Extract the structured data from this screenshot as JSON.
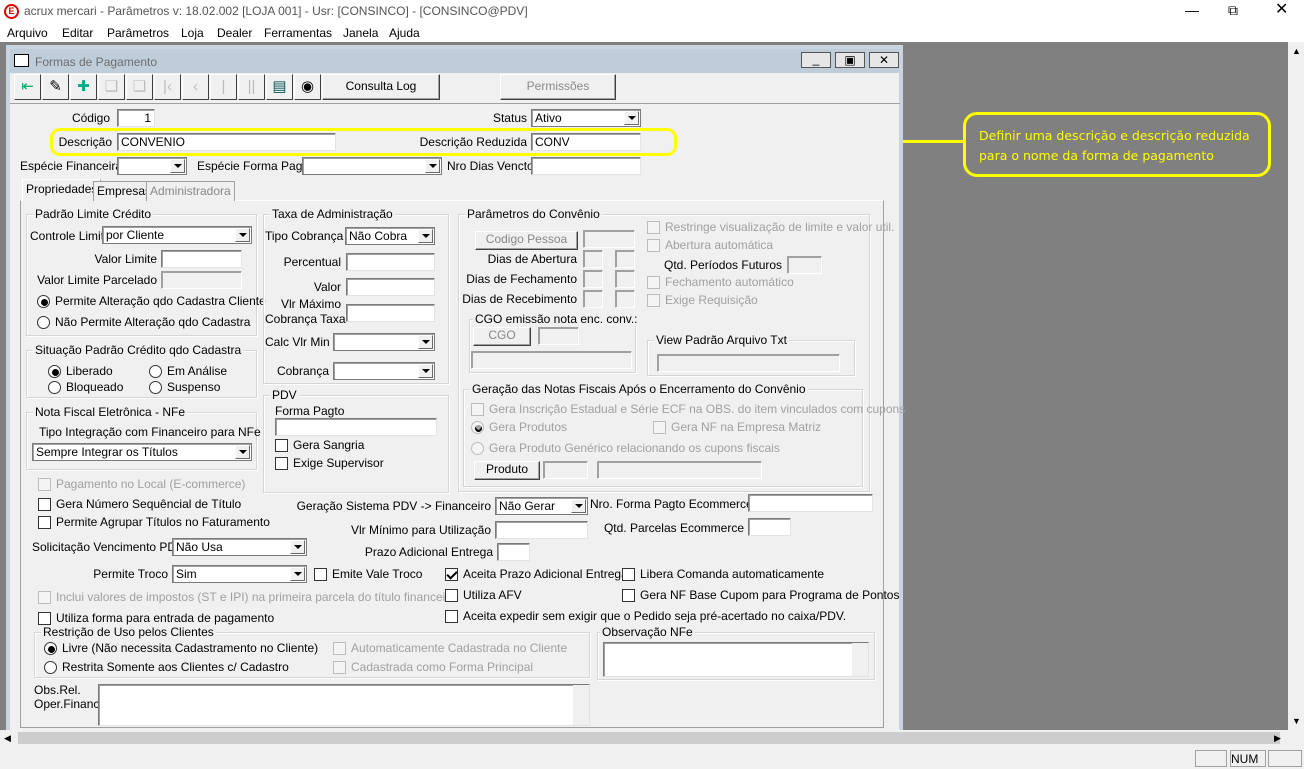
{
  "app": {
    "title": "acrux mercari - Parâmetros  v: 18.02.002   [LOJA 001] - Usr: [CONSINCO] - [CONSINCO@PDV]",
    "menu": [
      "Arquivo",
      "Editar",
      "Parâmetros",
      "Loja",
      "Dealer",
      "Ferramentas",
      "Janela",
      "Ajuda"
    ]
  },
  "window": {
    "title": "Formas de Pagamento"
  },
  "toolbar": {
    "consulta_log": "Consulta Log",
    "permissoes": "Permissões"
  },
  "header": {
    "codigo_label": "Código",
    "codigo": "1",
    "status_label": "Status",
    "status": "Ativo",
    "descricao_label": "Descrição",
    "descricao": "CONVENIO",
    "desc_reduzida_label": "Descrição Reduzida",
    "desc_reduzida": "CONV",
    "especie_fin_label": "Espécie Financeira",
    "especie_forma_label": "Espécie Forma Pagto",
    "nro_dias_label": "Nro Dias Vencto"
  },
  "callout": {
    "line1": "Definir uma descrição e descrição reduzida",
    "line2": "para o nome da forma de pagamento",
    "color": "#ffff00"
  },
  "tabs": [
    "Propriedades",
    "Empresas",
    "Administradora"
  ],
  "limite": {
    "title": "Padrão Limite Crédito",
    "controle_label": "Controle Limite",
    "controle": "por Cliente",
    "valor_label": "Valor Limite",
    "parcelado_label": "Valor Limite Parcelado",
    "radio1": "Permite Alteração qdo Cadastra Cliente",
    "radio2": "Não Permite Alteração qdo Cadastra"
  },
  "situacao": {
    "title": "Situação Padrão Crédito qdo Cadastra",
    "options": [
      "Liberado",
      "Em Análise",
      "Bloqueado",
      "Suspenso"
    ]
  },
  "nfe": {
    "title": "Nota Fiscal Eletrônica - NFe",
    "label": "Tipo Integração com Financeiro para NFe",
    "value": "Sempre Integrar os Títulos"
  },
  "taxa": {
    "title": "Taxa de Administração",
    "tipo_label": "Tipo Cobrança",
    "tipo": "Não Cobra",
    "percentual": "Percentual",
    "valor": "Valor",
    "vlr_max1": "Vlr Máximo",
    "vlr_max2": "Cobrança Taxa",
    "calc_min": "Calc Vlr Min",
    "cobranca": "Cobrança"
  },
  "pdv": {
    "title": "PDV",
    "forma_label": "Forma Pagto",
    "sangria": "Gera Sangria",
    "supervisor": "Exige Supervisor"
  },
  "convenio": {
    "title": "Parâmetros do Convênio",
    "codigo_pessoa": "Codigo Pessoa",
    "abertura": "Dias de Abertura",
    "fechamento": "Dias de Fechamento",
    "recebimento": "Dias de Recebimento",
    "cgo_title": "CGO emissão nota enc. conv.:",
    "cgo": "CGO",
    "restringe": "Restringe visualização de limite e valor util.",
    "abertura_auto": "Abertura automática",
    "qtd_periodos": "Qtd. Períodos Futuros",
    "fechamento_auto": "Fechamento automático",
    "exige_req": "Exige Requisição",
    "view_title": "View Padrão Arquivo Txt"
  },
  "geracao": {
    "title": "Geração das Notas Fiscais Após o Encerramento do Convênio",
    "inscricao": "Gera Inscrição Estadual e Série ECF na OBS. do item vinculados com cupons",
    "produtos": "Gera Produtos",
    "nf_matriz": "Gera NF na Empresa Matriz",
    "generico": "Gera Produto Genérico relacionando os cupons fiscais",
    "produto": "Produto"
  },
  "checks": {
    "pag_local": "Pagamento no Local (E-commerce)",
    "num_seq": "Gera Número Sequêncial de Título",
    "agrupar": "Permite Agrupar Títulos no Faturamento",
    "solic_label": "Solicitação Vencimento PDV",
    "solic": "Não Usa",
    "troco_label": "Permite Troco",
    "troco": "Sim",
    "vale_troco": "Emite Vale Troco",
    "impostos": "Inclui valores de impostos (ST e IPI) na primeira parcela do título financeiro",
    "entrada": "Utiliza forma para entrada de pagamento"
  },
  "restricao": {
    "title": "Restrição de Uso pelos Clientes",
    "livre": "Livre (Não necessita Cadastramento no Cliente)",
    "restrita": "Restrita Somente aos Clientes c/ Cadastro",
    "auto": "Automaticamente Cadastrada no Cliente",
    "principal": "Cadastrada como Forma Principal"
  },
  "obs": {
    "label1": "Obs.Rel.",
    "label2": "Oper.Financ."
  },
  "middle": {
    "ger_pdv_label": "Geração Sistema PDV -> Financeiro",
    "ger_pdv": "Não Gerar",
    "vlr_min": "Vlr Mínimo para Utilização",
    "prazo": "Prazo Adicional Entrega",
    "nro_ecom": "Nro. Forma Pagto Ecommerce",
    "qtd_parc": "Qtd. Parcelas Ecommerce",
    "aceita_prazo": "Aceita Prazo Adicional Entrega",
    "libera": "Libera Comanda automaticamente",
    "afv": "Utiliza AFV",
    "nf_cupom": "Gera NF Base Cupom para Programa de Pontos",
    "expedir": "Aceita expedir sem exigir que o Pedido seja pré-acertado no caixa/PDV.",
    "obs_nfe": "Observação NFe"
  },
  "statusbar": {
    "num": "NUM"
  }
}
